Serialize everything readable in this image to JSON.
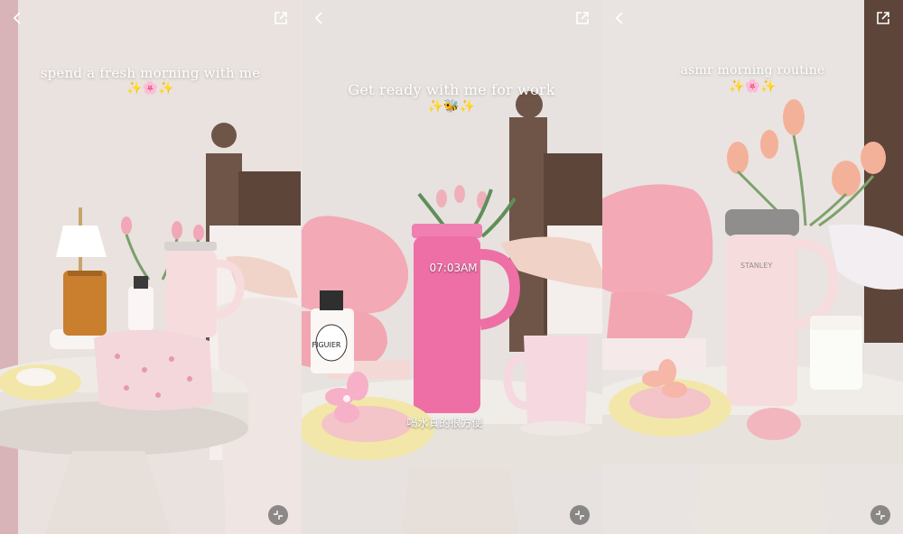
{
  "panels": [
    {
      "title": "spend a fresh morning with me",
      "emoji": "✨🌸✨"
    },
    {
      "title": "Get ready with me for work",
      "emoji": "✨🐝✨",
      "time_overlay": "07:03AM",
      "caption": "喝水真的很方便",
      "candle_label": "FIGUIER"
    },
    {
      "title": "asmr morning routine",
      "emoji": "✨🌸✨",
      "tumbler_brand": "STANLEY"
    }
  ],
  "colors": {
    "pink_lamp": "#f3a9b6",
    "tumbler_pink": "#ee6fa5",
    "tumbler_blush": "#f6dcdc",
    "table_terrazzo": "#eeeae6",
    "wall": "#e8e3df"
  }
}
